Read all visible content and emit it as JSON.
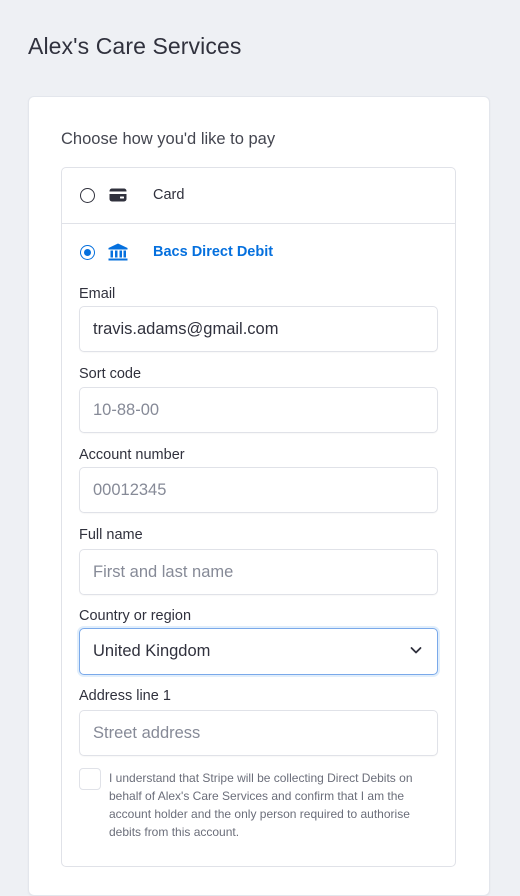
{
  "header": {
    "title": "Alex's Care Services"
  },
  "payment": {
    "heading": "Choose how you'd like to pay",
    "methods": [
      {
        "label": "Card",
        "selected": false,
        "icon": "card-icon"
      },
      {
        "label": "Bacs Direct Debit",
        "selected": true,
        "icon": "bank-icon"
      }
    ],
    "accent_color": "#0570de"
  },
  "form": {
    "email": {
      "label": "Email",
      "value": "travis.adams@gmail.com",
      "placeholder": ""
    },
    "sort_code": {
      "label": "Sort code",
      "value": "",
      "placeholder": "10-88-00"
    },
    "account_number": {
      "label": "Account number",
      "value": "",
      "placeholder": "00012345"
    },
    "full_name": {
      "label": "Full name",
      "value": "",
      "placeholder": "First and last name"
    },
    "country": {
      "label": "Country or region",
      "value": "United Kingdom"
    },
    "address_line1": {
      "label": "Address line 1",
      "value": "",
      "placeholder": "Street address"
    },
    "mandate": {
      "checked": false,
      "text": "I understand that Stripe will be collecting Direct Debits on behalf of Alex's Care Services and confirm that I am the account holder and the only person required to authorise debits from this account."
    }
  }
}
